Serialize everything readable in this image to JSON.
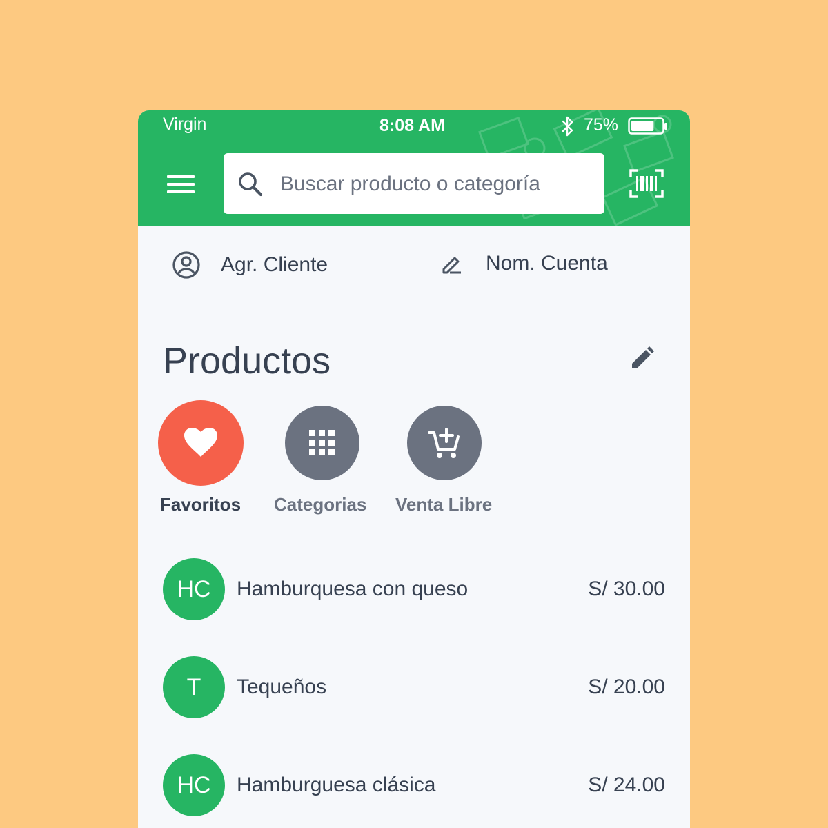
{
  "status_bar": {
    "carrier": "Virgin",
    "time": "8:08 AM",
    "battery_percent": "75%",
    "battery_level": 0.75,
    "icons": [
      "bluetooth-icon",
      "battery-icon"
    ]
  },
  "header": {
    "menu_icon": "hamburger-menu-icon",
    "search_placeholder": "Buscar producto o categoría",
    "search_value": "",
    "scan_icon": "barcode-scan-icon",
    "background_color": "#26b563"
  },
  "actions": {
    "client_label": "Agr. Cliente",
    "client_icon": "user-circle-icon",
    "account_label": "Nom. Cuenta",
    "account_icon": "pencil-line-icon"
  },
  "products_section": {
    "title": "Productos",
    "edit_icon": "pencil-icon",
    "categories": [
      {
        "label": "Favoritos",
        "icon": "heart-icon",
        "color": "#f5604a",
        "active": true
      },
      {
        "label": "Categorias",
        "icon": "grid-icon",
        "color": "#6b7280",
        "active": false
      },
      {
        "label": "Venta Libre",
        "icon": "cart-add-icon",
        "color": "#6b7280",
        "active": false
      }
    ],
    "items": [
      {
        "initials": "HC",
        "name": "Hamburquesa con queso",
        "price": "S/ 30.00"
      },
      {
        "initials": "T",
        "name": "Tequeños",
        "price": "S/ 20.00"
      },
      {
        "initials": "HC",
        "name": "Hamburguesa clásica",
        "price": "S/ 24.00"
      }
    ]
  },
  "colors": {
    "page_background": "#fdc981",
    "brand_green": "#26b563",
    "favorite_red": "#f5604a",
    "neutral_gray": "#6b7280",
    "content_background": "#f6f8fb"
  }
}
